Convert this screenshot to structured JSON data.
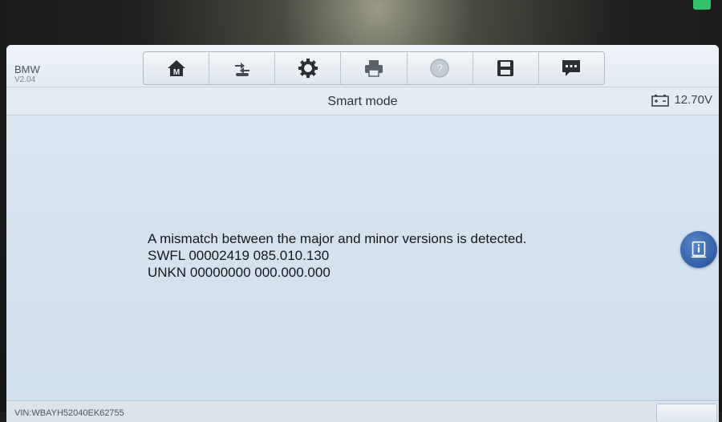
{
  "header": {
    "vehicle_make": "BMW",
    "software_version": "V2.04",
    "toolbar": [
      {
        "icon": "home-icon"
      },
      {
        "icon": "vehicle-swap-icon"
      },
      {
        "icon": "gear-icon"
      },
      {
        "icon": "printer-icon"
      },
      {
        "icon": "help-icon"
      },
      {
        "icon": "save-icon"
      },
      {
        "icon": "message-icon"
      }
    ]
  },
  "titlebar": {
    "title": "Smart mode",
    "battery_voltage": "12.70V"
  },
  "main": {
    "message_lines": [
      "A mismatch between the major and minor versions is detected.",
      "SWFL 00002419 085.010.130",
      "UNKN 00000000 000.000.000"
    ]
  },
  "footer": {
    "vin": "VIN:WBAYH52040EK62755"
  },
  "colors": {
    "screen_background": "#d6e3ef",
    "info_button": "#2f5ea8",
    "status_indicator": "#2fc46a"
  }
}
